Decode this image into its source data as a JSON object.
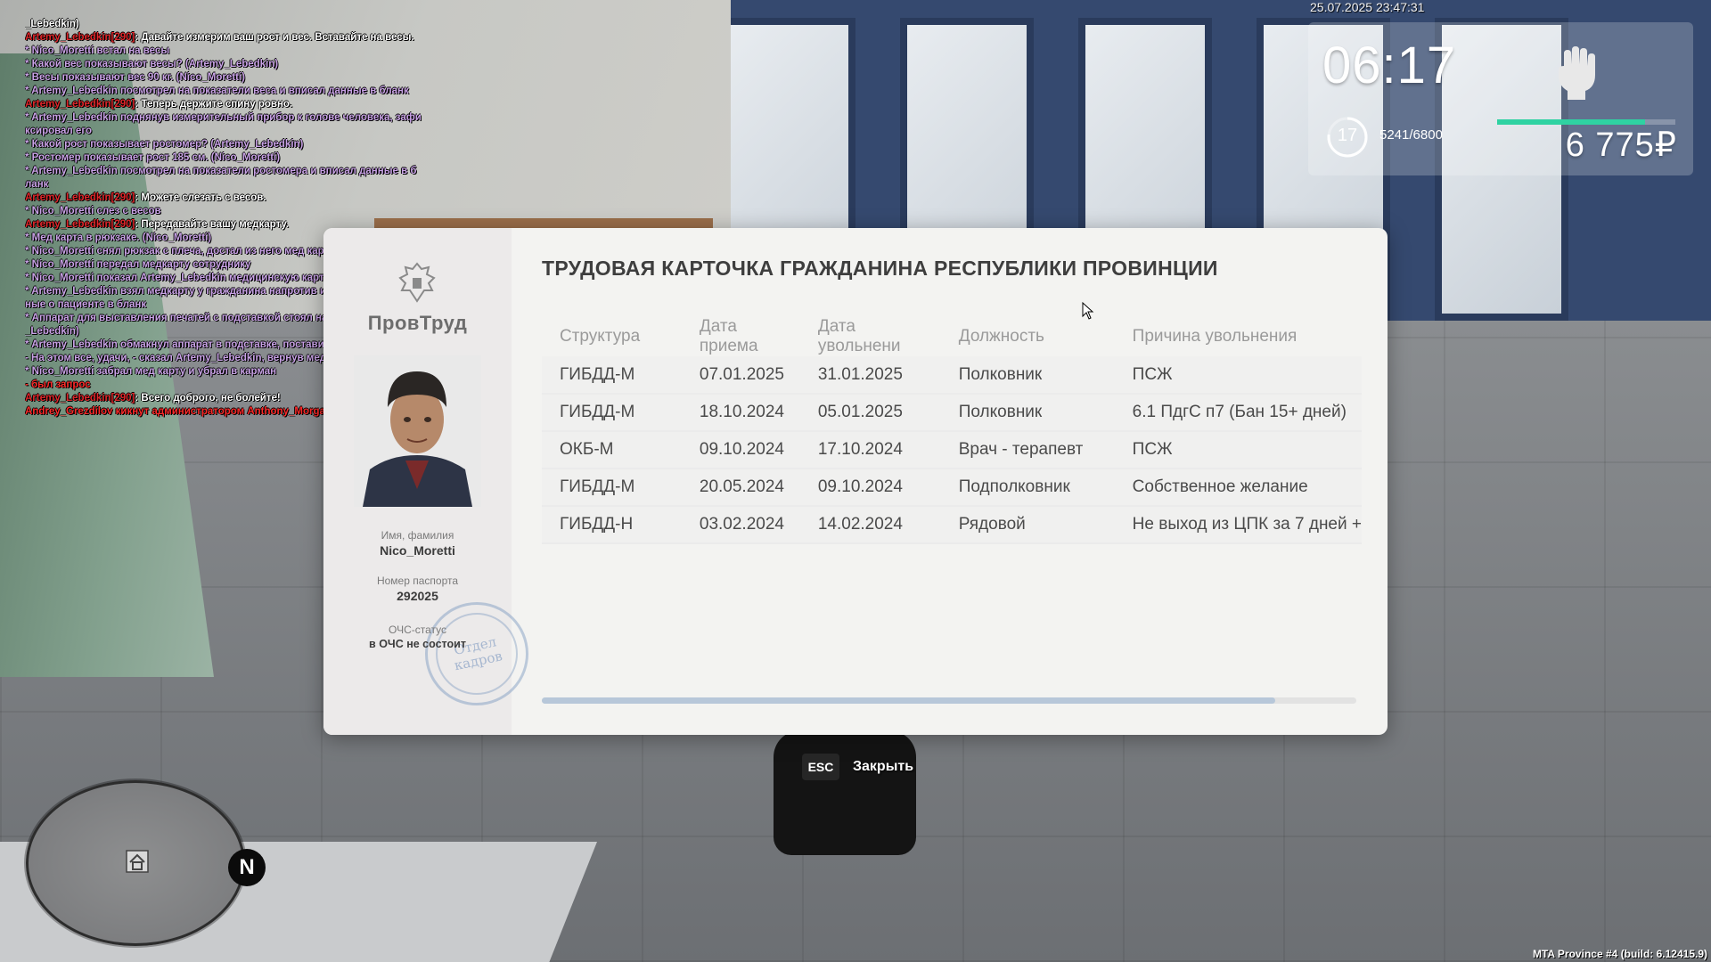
{
  "chat": [
    {
      "parts": [
        {
          "c": "plain",
          "t": "_Lebedkin)"
        }
      ]
    },
    {
      "parts": [
        {
          "c": "who",
          "t": "Artemy_Lebedkin[290]"
        },
        {
          "c": "said",
          "t": ": Давайте измерим ваш рост и вес. Вставайте на весы."
        }
      ]
    },
    {
      "parts": [
        {
          "c": "me",
          "t": "* Nico_Moretti встал на весы"
        }
      ]
    },
    {
      "parts": [
        {
          "c": "me",
          "t": "* Какой вес показывают весы? (Artemy_Lebedkin)"
        }
      ]
    },
    {
      "parts": [
        {
          "c": "me",
          "t": "* Весы показывают вес 90 кг. (Nico_Moretti)"
        }
      ]
    },
    {
      "parts": [
        {
          "c": "me",
          "t": "* Artemy_Lebedkin посмотрел на показатели веса и вписал данные в бланк"
        }
      ]
    },
    {
      "parts": [
        {
          "c": "who",
          "t": "Artemy_Lebedkin[290]"
        },
        {
          "c": "said",
          "t": ": Теперь держите спину ровно."
        }
      ]
    },
    {
      "parts": [
        {
          "c": "me",
          "t": "* Artemy_Lebedkin поднянув измерительный прибор к голове человека, зафи"
        }
      ]
    },
    {
      "parts": [
        {
          "c": "me",
          "t": "ксировал его"
        }
      ]
    },
    {
      "parts": [
        {
          "c": "me",
          "t": "* Какой рост показывает ростомер? (Artemy_Lebedkin)"
        }
      ]
    },
    {
      "parts": [
        {
          "c": "me",
          "t": "* Ростомер показывает рост 185 см. (Nico_Moretti)"
        }
      ]
    },
    {
      "parts": [
        {
          "c": "me",
          "t": "* Artemy_Lebedkin посмотрел на показатели ростомера и вписал данные в б"
        }
      ]
    },
    {
      "parts": [
        {
          "c": "me",
          "t": "ланк"
        }
      ]
    },
    {
      "parts": [
        {
          "c": "who",
          "t": "Artemy_Lebedkin[290]"
        },
        {
          "c": "said",
          "t": ": Можете слезать с весов."
        }
      ]
    },
    {
      "parts": [
        {
          "c": "me",
          "t": "* Nico_Moretti слез с весов"
        }
      ]
    },
    {
      "parts": [
        {
          "c": "who",
          "t": "Artemy_Lebedkin[290]"
        },
        {
          "c": "said",
          "t": ": Передавайте вашу медкарту."
        }
      ]
    },
    {
      "parts": [
        {
          "c": "me",
          "t": "* Мед карта в рюкзаке. (Nico_Moretti)"
        }
      ]
    },
    {
      "parts": [
        {
          "c": "me",
          "t": "* Nico_Moretti снял рюкзак с плеча, достал из него мед карту и надел рюкзак"
        }
      ]
    },
    {
      "parts": [
        {
          "c": "me",
          "t": "* Nico_Moretti передал медкарту сотруднику"
        }
      ]
    },
    {
      "parts": [
        {
          "c": "me",
          "t": "* Nico_Moretti показал Artemy_Lebedkin медицинскую карту"
        }
      ]
    },
    {
      "parts": [
        {
          "c": "me",
          "t": "* Artemy_Lebedkin взял медкарту у гражданина напротив и зафиксировал дан"
        }
      ]
    },
    {
      "parts": [
        {
          "c": "me",
          "t": "ные о пациенте в бланк"
        }
      ]
    },
    {
      "parts": [
        {
          "c": "me",
          "t": "* Аппарат для выставления печатей с подставкой стоял на столе (Artemy"
        }
      ]
    },
    {
      "parts": [
        {
          "c": "me",
          "t": "_Lebedkin)"
        }
      ]
    },
    {
      "parts": [
        {
          "c": "me",
          "t": "* Artemy_Lebedkin обмакнул аппарат в подставке, поставил печать"
        }
      ]
    },
    {
      "parts": [
        {
          "c": "me",
          "t": "- На этом все, удачи, - сказал Artemy_Lebedkin, вернув мед.карту владельцу."
        }
      ]
    },
    {
      "parts": [
        {
          "c": "me",
          "t": "* Nico_Moretti забрал мед карту и убрал в карман"
        }
      ]
    },
    {
      "parts": [
        {
          "c": "red",
          "t": "- был запрос"
        }
      ]
    },
    {
      "parts": [
        {
          "c": "who",
          "t": "Artemy_Lebedkin[290]"
        },
        {
          "c": "said",
          "t": ": Всего доброго, не болейте!"
        }
      ]
    },
    {
      "parts": [
        {
          "c": "red",
          "t": "Andrey_Grezdilov кикнут администратором Anthony_Morgan (afk 30+)"
        }
      ]
    }
  ],
  "hud": {
    "datetime": "25.07.2025 23:47:31",
    "time": "06:17",
    "level": "17",
    "exp": "5241/6800",
    "exp_fraction": 0.77,
    "health_fraction": 0.83,
    "money": "6 775₽",
    "health_color": "#2fd2a2"
  },
  "card": {
    "title": "ТРУДОВАЯ КАРТОЧКА ГРАЖДАНИНА РЕСПУБЛИКИ ПРОВИНЦИИ",
    "org": "ПровТруд",
    "name_label": "Имя, фамилия",
    "name": "Nico_Moretti",
    "passport_label": "Номер паспорта",
    "passport": "292025",
    "status_label": "ОЧС-статус",
    "status": "в ОЧС не состоит",
    "stamp_text": "Отдел кадров",
    "columns": [
      "Структура",
      "Дата приема",
      "Дата увольнени",
      "Должность",
      "Причина увольнения"
    ],
    "rows": [
      [
        "ГИБДД-М",
        "07.01.2025",
        "31.01.2025",
        "Полковник",
        "ПСЖ"
      ],
      [
        "ГИБДД-М",
        "18.10.2024",
        "05.01.2025",
        "Полковник",
        "6.1 ПдгС п7 (Бан 15+ дней)"
      ],
      [
        "ОКБ-М",
        "09.10.2024",
        "17.10.2024",
        "Врач - терапевт",
        "ПСЖ"
      ],
      [
        "ГИБДД-М",
        "20.05.2024",
        "09.10.2024",
        "Подполковник",
        "Собственное желание"
      ],
      [
        "ГИБДД-Н",
        "03.02.2024",
        "14.02.2024",
        "Рядовой",
        "Не выход из ЦПК за 7 дней +"
      ]
    ],
    "scroll_fraction": 0.9
  },
  "controls": {
    "esc_key": "ESC",
    "close_label": "Закрыть"
  },
  "minimap": {
    "north": "N"
  },
  "build": "MTA Province #4 (build: 6.12415.9)"
}
